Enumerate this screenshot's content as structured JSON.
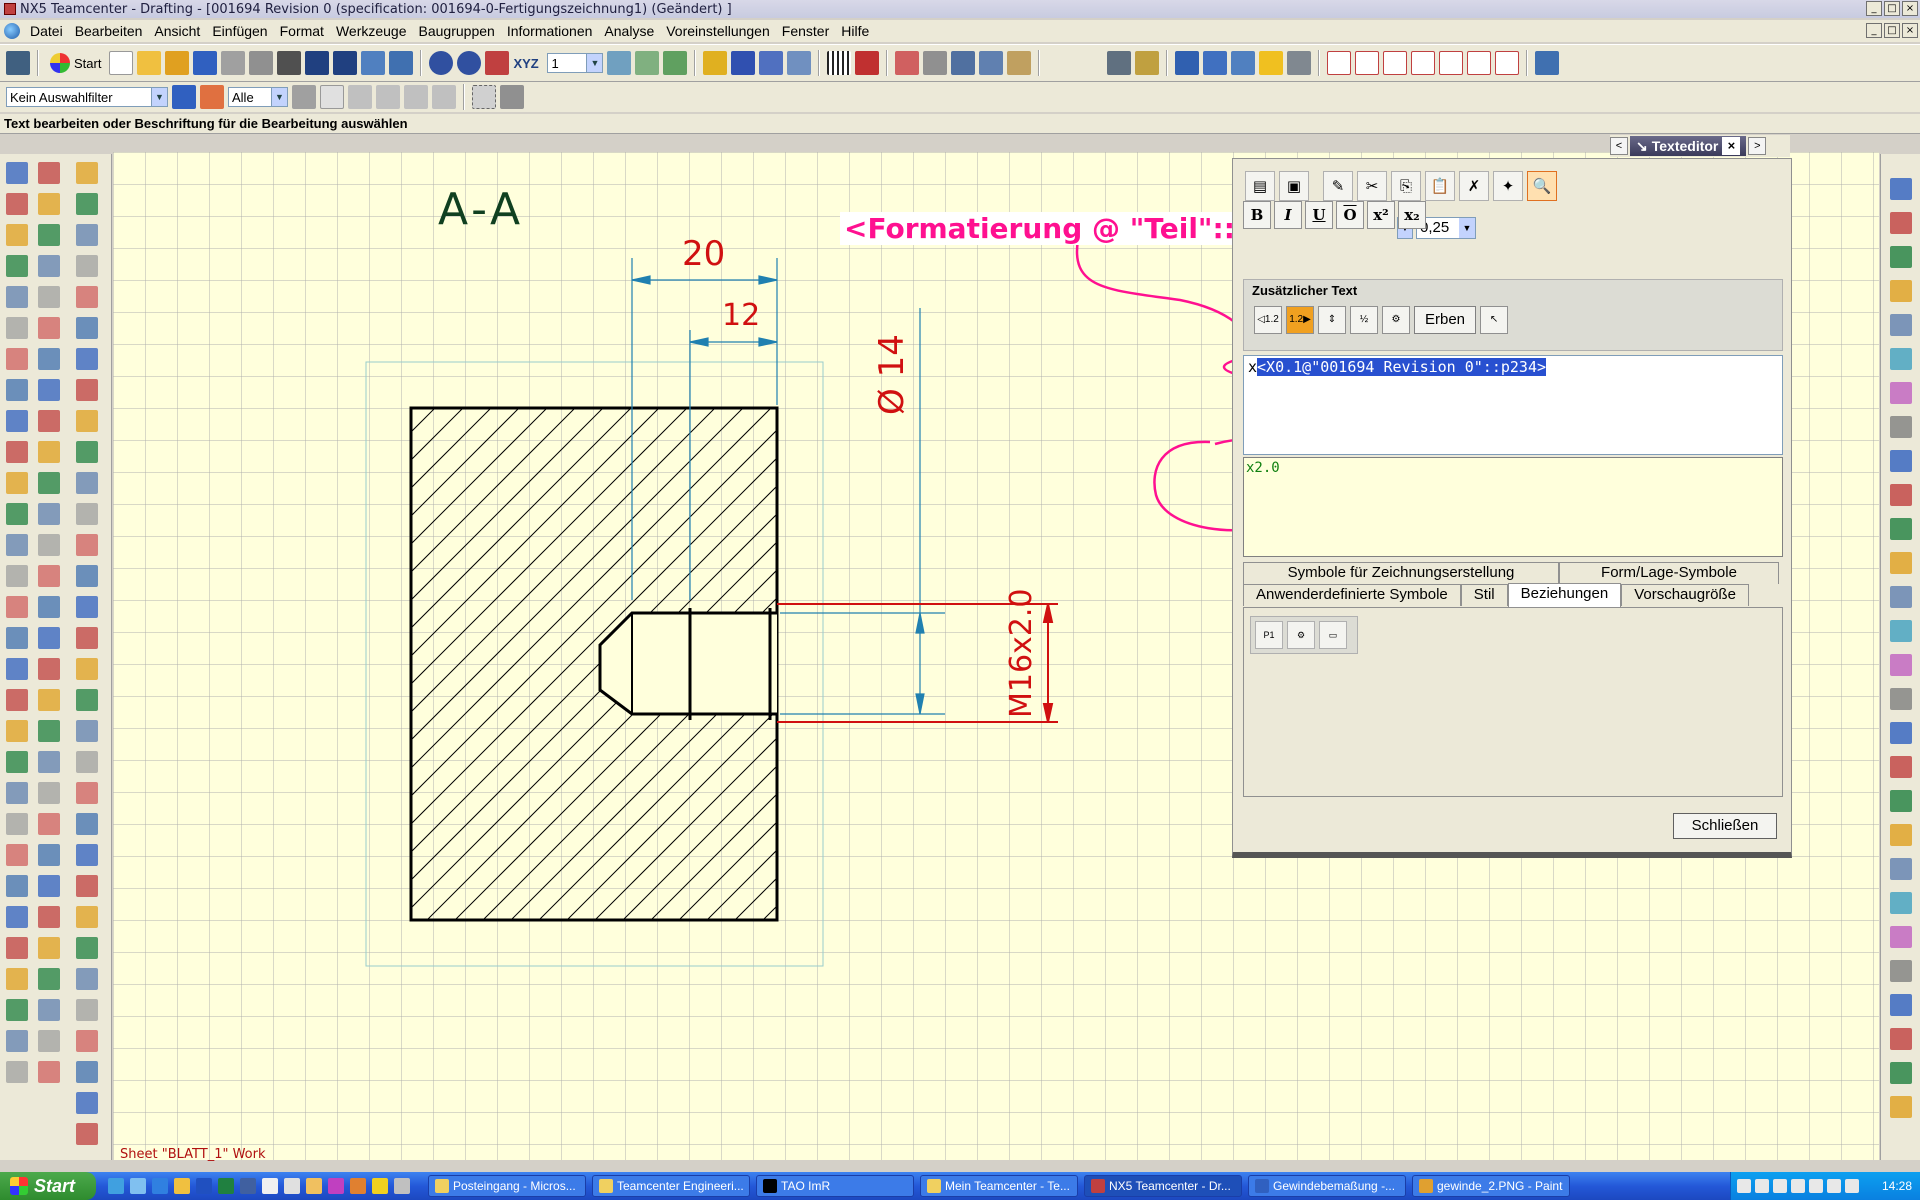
{
  "window": {
    "title": "NX5 Teamcenter - Drafting - [001694 Revision 0 (specification: 001694-0-Fertigungszeichnung1) (Geändert) ]",
    "min": "_",
    "max": "□",
    "close": "×"
  },
  "menu": [
    "Datei",
    "Bearbeiten",
    "Ansicht",
    "Einfügen",
    "Format",
    "Werkzeuge",
    "Baugruppen",
    "Informationen",
    "Analyse",
    "Voreinstellungen",
    "Fenster",
    "Hilfe"
  ],
  "toolbar": {
    "start_label": "Start",
    "layer_value": "1",
    "filter_value": "Kein Auswahlfilter",
    "scope_value": "Alle",
    "wcs_label": "XYZ"
  },
  "status_line": "Text bearbeiten oder Beschriftung für die Bearbeitung auswählen",
  "drawing": {
    "section_label": "A-A",
    "dim_20": "20",
    "dim_12": "12",
    "dim_dia": "Ø 14",
    "thread_label": "M16x2.0",
    "sheet_label": "Sheet \"BLATT_1\" Work",
    "colors": {
      "dimension": "#2080b0",
      "text_red": "#d01010",
      "geometry": "#000000",
      "annotation": "#ff1090"
    }
  },
  "annotation_text": "<Formatierung @ \"Teil\"::Ausdruck",
  "texteditor": {
    "title": "Texteditor",
    "nav_left": "<",
    "nav_right": ">",
    "close": "×",
    "size_value": "0,25",
    "fmt_buttons": [
      "B",
      "I",
      "U",
      "O",
      "x²",
      "x₂"
    ],
    "zusatz_title": "Zusätzlicher Text",
    "erben_label": "Erben",
    "edit_prefix": "x",
    "edit_selected": "<X0.1@\"001694 Revision 0\"::p234>",
    "preview_text": "x2.0",
    "tabs_row1": [
      "Symbole für Zeichnungserstellung",
      "Form/Lage-Symbole"
    ],
    "tabs_row2": [
      "Anwenderdefinierte Symbole",
      "Stil",
      "Beziehungen",
      "Vorschaugröße"
    ],
    "active_tab": "Beziehungen",
    "close_button": "Schließen"
  },
  "taskbar": {
    "start": "Start",
    "tasks": [
      "Posteingang - Micros...",
      "Teamcenter Engineeri...",
      "TAO ImR",
      "Mein Teamcenter - Te...",
      "NX5 Teamcenter - Dr...",
      "Gewindebemaßung -...",
      "gewinde_2.PNG - Paint"
    ],
    "clock": "14:28"
  }
}
